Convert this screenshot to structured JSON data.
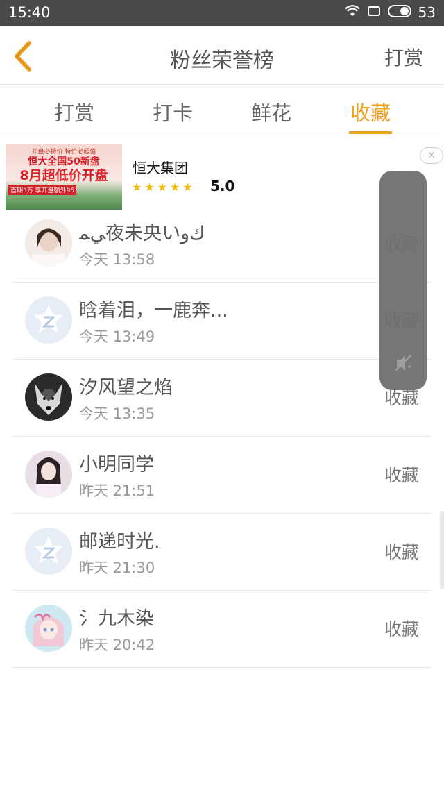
{
  "status": {
    "time": "15:40",
    "battery": "53"
  },
  "nav": {
    "title": "粉丝荣誉榜",
    "right_label": "打赏"
  },
  "tabs": [
    {
      "label": "打赏",
      "active": false
    },
    {
      "label": "打卡",
      "active": false
    },
    {
      "label": "鲜花",
      "active": false
    },
    {
      "label": "收藏",
      "active": true
    }
  ],
  "ad": {
    "image_text": {
      "line1": "开盘必特价 特价必超值",
      "line2": "恒大全国50新盘",
      "line3": "8月超低价开盘",
      "line4": "首期3万 享开盘额外95"
    },
    "title": "恒大集团",
    "rating": "5.0"
  },
  "list": [
    {
      "name": "ﻲﻤ夜未央いﻙﻭ",
      "time": "今天 13:58",
      "type": "收藏",
      "avatar": "photo"
    },
    {
      "name": "晗着泪，一鹿奔...",
      "time": "今天 13:49",
      "type": "收藏",
      "avatar": "default"
    },
    {
      "name": "汐风望之焰",
      "time": "今天 13:35",
      "type": "收藏",
      "avatar": "husky"
    },
    {
      "name": "小明同学",
      "time": "昨天 21:51",
      "type": "收藏",
      "avatar": "girl"
    },
    {
      "name": "邮递时光.",
      "time": "昨天 21:30",
      "type": "收藏",
      "avatar": "default"
    },
    {
      "name": "氵九木染",
      "time": "昨天 20:42",
      "type": "收藏",
      "avatar": "anime"
    }
  ],
  "colors": {
    "accent": "#f0a020",
    "status_bar": "#4a4a4a"
  }
}
